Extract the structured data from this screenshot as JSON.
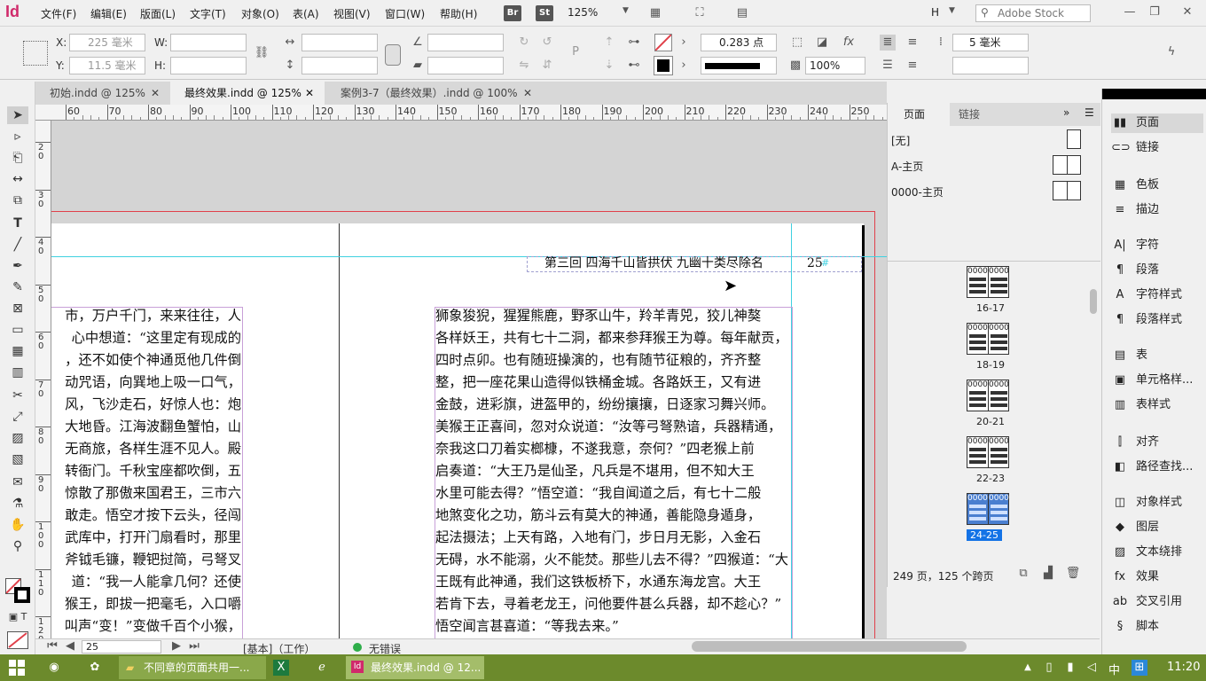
{
  "app": {
    "logo": "Id"
  },
  "menu": [
    "文件(F)",
    "编辑(E)",
    "版面(L)",
    "文字(T)",
    "对象(O)",
    "表(A)",
    "视图(V)",
    "窗口(W)",
    "帮助(H)"
  ],
  "appbar": {
    "br": "Br",
    "st": "St",
    "zoom": "125%",
    "workspace": "H",
    "search_placeholder": "Adobe Stock"
  },
  "control": {
    "x_label": "X:",
    "x_value": "225 毫米",
    "y_label": "Y:",
    "y_value": "11.5 毫米",
    "w_label": "W:",
    "h_label": "H:",
    "stroke_weight": "0.283 点",
    "opacity": "100%",
    "grid_value": "5 毫米"
  },
  "tabs": [
    {
      "label": "初始.indd @ 125%"
    },
    {
      "label": "最终效果.indd @ 125%"
    },
    {
      "label": "案例3-7（最终效果）.indd @ 100%"
    }
  ],
  "ruler": {
    "h": [
      "60",
      "70",
      "80",
      "90",
      "100",
      "110",
      "120",
      "130",
      "140",
      "150",
      "160",
      "170",
      "180",
      "190",
      "200",
      "210",
      "220",
      "230",
      "240",
      "250"
    ],
    "v": [
      "20",
      "30",
      "40",
      "50",
      "60",
      "70",
      "80",
      "90",
      "100",
      "110",
      "120"
    ]
  },
  "document": {
    "header": "第三回 四海千山皆拱伏 九幽十类尽除名",
    "page_number": "25",
    "left_lines": [
      "市，万户千门，来来往往，人",
      "心中想道：“这里定有现成的",
      "，还不如使个神通觅他几件倒",
      "动咒语，向巽地上吸一口气，",
      "风，飞沙走石，好惊人也：炮",
      "大地昏。江海波翻鱼蟹怕，山",
      "无商旅，各样生涯不见人。殿",
      "转衙门。千秋宝座都吹倒，五",
      "惊散了那傲来国君王，三市六",
      "敢走。悟空才按下云头，径闯",
      "武库中，打开门扇看时，那里",
      "斧钺毛镰，鞭钯挝简，弓弩叉",
      "道：“我一人能拿几何？还使",
      "猴王，即拔一把毫毛，入口嚼",
      "叫声“变！”变做千百个小猴，"
    ],
    "right_lines": [
      "狮象狻猊，猩猩熊鹿，野豕山牛，羚羊青兕，狡儿神獒",
      "各样妖王，共有七十二洞，都来参拜猴王为尊。每年献贡，",
      "四时点卯。也有随班操演的，也有随节征粮的，齐齐整",
      "整，把一座花果山造得似铁桶金城。各路妖王，又有进",
      "金鼓，进彩旗，进盔甲的，纷纷攘攘，日逐家习舞兴师。",
      "美猴王正喜间，忽对众说道：“汝等弓弩熟谙，兵器精通，",
      "奈我这口刀着实榔槺，不遂我意，奈何？”四老猴上前",
      "启奏道：“大王乃是仙圣，凡兵是不堪用，但不知大王",
      "水里可能去得？”悟空道：“我自闻道之后，有七十二般",
      "地煞变化之功，筋斗云有莫大的神通，善能隐身遁身，",
      "起法摄法；上天有路，入地有门，步日月无影，入金石",
      "无碍，水不能溺，火不能焚。那些儿去不得？”四猴道：“大",
      "王既有此神通，我们这铁板桥下，水通东海龙宫。大王",
      "若肯下去，寻着老龙王，问他要件甚么兵器，却不趁心？”",
      "悟空闻言甚喜道：“等我去来。”"
    ]
  },
  "status": {
    "page_field": "25",
    "style": "[基本]（工作）",
    "preflight": "无错误"
  },
  "pages_panel": {
    "tabs": [
      "页面",
      "链接"
    ],
    "masters": [
      "[无]",
      "A-主页",
      "0000-主页"
    ],
    "spreads": [
      {
        "label": "16-17",
        "selected": false
      },
      {
        "label": "18-19",
        "selected": false
      },
      {
        "label": "20-21",
        "selected": false
      },
      {
        "label": "22-23",
        "selected": false
      },
      {
        "label": "24-25",
        "selected": true
      }
    ],
    "thumb_prefix": "0000",
    "footer": "249 页，125 个跨页"
  },
  "dock": [
    {
      "label": "页面",
      "icon": "pages-icon",
      "glyph": "▮▮"
    },
    {
      "label": "链接",
      "icon": "links-icon",
      "glyph": "⊂⊃"
    },
    {
      "label": "色板",
      "icon": "swatches-icon",
      "glyph": "▦"
    },
    {
      "label": "描边",
      "icon": "stroke-icon",
      "glyph": "≡"
    },
    {
      "label": "字符",
      "icon": "character-icon",
      "glyph": "A|"
    },
    {
      "label": "段落",
      "icon": "paragraph-icon",
      "glyph": "¶"
    },
    {
      "label": "字符样式",
      "icon": "character-styles-icon",
      "glyph": "A"
    },
    {
      "label": "段落样式",
      "icon": "paragraph-styles-icon",
      "glyph": "¶"
    },
    {
      "label": "表",
      "icon": "table-icon",
      "glyph": "▤"
    },
    {
      "label": "单元格样...",
      "icon": "cell-styles-icon",
      "glyph": "▣"
    },
    {
      "label": "表样式",
      "icon": "table-styles-icon",
      "glyph": "▥"
    },
    {
      "label": "对齐",
      "icon": "align-icon",
      "glyph": "⫿"
    },
    {
      "label": "路径查找...",
      "icon": "pathfinder-icon",
      "glyph": "◧"
    },
    {
      "label": "对象样式",
      "icon": "object-styles-icon",
      "glyph": "◫"
    },
    {
      "label": "图层",
      "icon": "layers-icon",
      "glyph": "◆"
    },
    {
      "label": "文本绕排",
      "icon": "text-wrap-icon",
      "glyph": "▨"
    },
    {
      "label": "效果",
      "icon": "effects-icon",
      "glyph": "fx"
    },
    {
      "label": "交叉引用",
      "icon": "cross-reference-icon",
      "glyph": "ab"
    },
    {
      "label": "脚本",
      "icon": "scripts-icon",
      "glyph": "§"
    }
  ],
  "taskbar": {
    "items": [
      "不同章的页面共用一...",
      "最终效果.indd @ 12..."
    ],
    "ime": "中",
    "time": "11:20"
  },
  "colors": {
    "accent": "#1473e6",
    "guide_cyan": "#3fd1e0",
    "bleed_red": "#e0404a",
    "taskbar": "#6c8a2c",
    "indesign": "#d02a6b"
  }
}
